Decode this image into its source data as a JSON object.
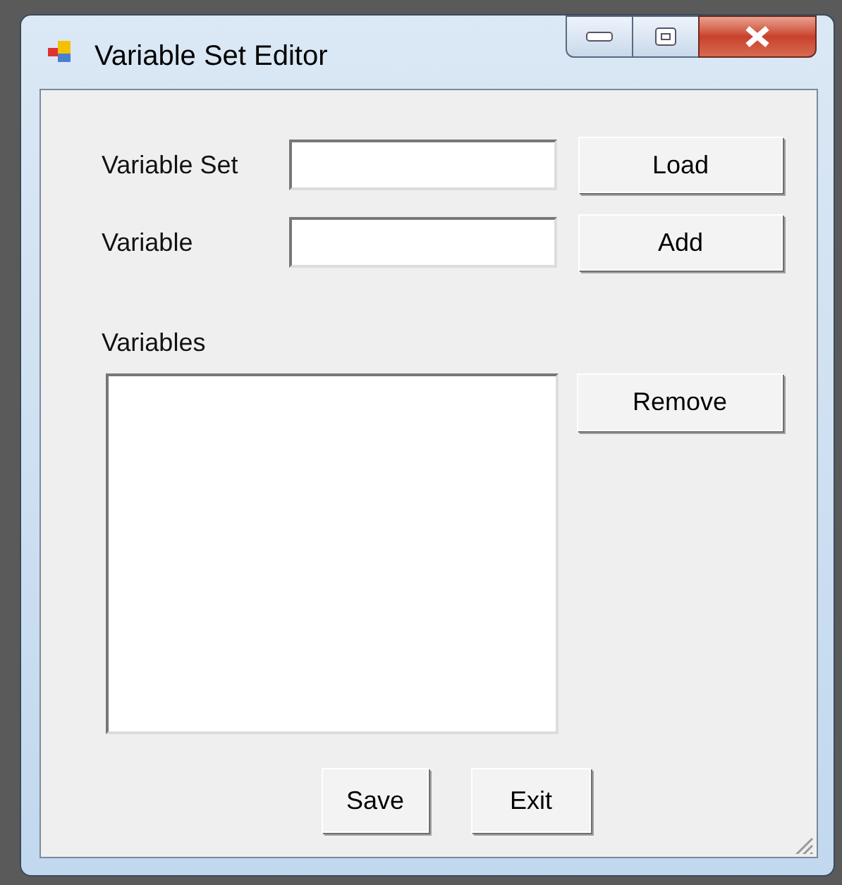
{
  "window": {
    "title": "Variable Set Editor"
  },
  "fields": [
    {
      "label": "Variable Set",
      "button": "Load"
    },
    {
      "label": "Variable",
      "button": "Add"
    }
  ],
  "variables": {
    "label": "Variables",
    "button": "Remove"
  },
  "footer_buttons": [
    "Save",
    "Exit"
  ]
}
